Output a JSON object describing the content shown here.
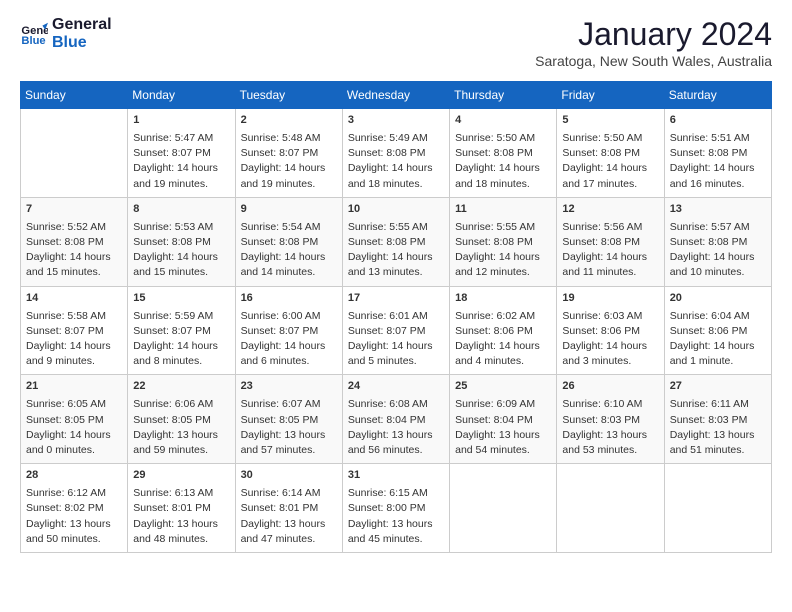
{
  "header": {
    "logo_line1": "General",
    "logo_line2": "Blue",
    "month": "January 2024",
    "location": "Saratoga, New South Wales, Australia"
  },
  "days_of_week": [
    "Sunday",
    "Monday",
    "Tuesday",
    "Wednesday",
    "Thursday",
    "Friday",
    "Saturday"
  ],
  "weeks": [
    [
      {
        "day": "",
        "content": ""
      },
      {
        "day": "1",
        "content": "Sunrise: 5:47 AM\nSunset: 8:07 PM\nDaylight: 14 hours\nand 19 minutes."
      },
      {
        "day": "2",
        "content": "Sunrise: 5:48 AM\nSunset: 8:07 PM\nDaylight: 14 hours\nand 19 minutes."
      },
      {
        "day": "3",
        "content": "Sunrise: 5:49 AM\nSunset: 8:08 PM\nDaylight: 14 hours\nand 18 minutes."
      },
      {
        "day": "4",
        "content": "Sunrise: 5:50 AM\nSunset: 8:08 PM\nDaylight: 14 hours\nand 18 minutes."
      },
      {
        "day": "5",
        "content": "Sunrise: 5:50 AM\nSunset: 8:08 PM\nDaylight: 14 hours\nand 17 minutes."
      },
      {
        "day": "6",
        "content": "Sunrise: 5:51 AM\nSunset: 8:08 PM\nDaylight: 14 hours\nand 16 minutes."
      }
    ],
    [
      {
        "day": "7",
        "content": "Sunrise: 5:52 AM\nSunset: 8:08 PM\nDaylight: 14 hours\nand 15 minutes."
      },
      {
        "day": "8",
        "content": "Sunrise: 5:53 AM\nSunset: 8:08 PM\nDaylight: 14 hours\nand 15 minutes."
      },
      {
        "day": "9",
        "content": "Sunrise: 5:54 AM\nSunset: 8:08 PM\nDaylight: 14 hours\nand 14 minutes."
      },
      {
        "day": "10",
        "content": "Sunrise: 5:55 AM\nSunset: 8:08 PM\nDaylight: 14 hours\nand 13 minutes."
      },
      {
        "day": "11",
        "content": "Sunrise: 5:55 AM\nSunset: 8:08 PM\nDaylight: 14 hours\nand 12 minutes."
      },
      {
        "day": "12",
        "content": "Sunrise: 5:56 AM\nSunset: 8:08 PM\nDaylight: 14 hours\nand 11 minutes."
      },
      {
        "day": "13",
        "content": "Sunrise: 5:57 AM\nSunset: 8:08 PM\nDaylight: 14 hours\nand 10 minutes."
      }
    ],
    [
      {
        "day": "14",
        "content": "Sunrise: 5:58 AM\nSunset: 8:07 PM\nDaylight: 14 hours\nand 9 minutes."
      },
      {
        "day": "15",
        "content": "Sunrise: 5:59 AM\nSunset: 8:07 PM\nDaylight: 14 hours\nand 8 minutes."
      },
      {
        "day": "16",
        "content": "Sunrise: 6:00 AM\nSunset: 8:07 PM\nDaylight: 14 hours\nand 6 minutes."
      },
      {
        "day": "17",
        "content": "Sunrise: 6:01 AM\nSunset: 8:07 PM\nDaylight: 14 hours\nand 5 minutes."
      },
      {
        "day": "18",
        "content": "Sunrise: 6:02 AM\nSunset: 8:06 PM\nDaylight: 14 hours\nand 4 minutes."
      },
      {
        "day": "19",
        "content": "Sunrise: 6:03 AM\nSunset: 8:06 PM\nDaylight: 14 hours\nand 3 minutes."
      },
      {
        "day": "20",
        "content": "Sunrise: 6:04 AM\nSunset: 8:06 PM\nDaylight: 14 hours\nand 1 minute."
      }
    ],
    [
      {
        "day": "21",
        "content": "Sunrise: 6:05 AM\nSunset: 8:05 PM\nDaylight: 14 hours\nand 0 minutes."
      },
      {
        "day": "22",
        "content": "Sunrise: 6:06 AM\nSunset: 8:05 PM\nDaylight: 13 hours\nand 59 minutes."
      },
      {
        "day": "23",
        "content": "Sunrise: 6:07 AM\nSunset: 8:05 PM\nDaylight: 13 hours\nand 57 minutes."
      },
      {
        "day": "24",
        "content": "Sunrise: 6:08 AM\nSunset: 8:04 PM\nDaylight: 13 hours\nand 56 minutes."
      },
      {
        "day": "25",
        "content": "Sunrise: 6:09 AM\nSunset: 8:04 PM\nDaylight: 13 hours\nand 54 minutes."
      },
      {
        "day": "26",
        "content": "Sunrise: 6:10 AM\nSunset: 8:03 PM\nDaylight: 13 hours\nand 53 minutes."
      },
      {
        "day": "27",
        "content": "Sunrise: 6:11 AM\nSunset: 8:03 PM\nDaylight: 13 hours\nand 51 minutes."
      }
    ],
    [
      {
        "day": "28",
        "content": "Sunrise: 6:12 AM\nSunset: 8:02 PM\nDaylight: 13 hours\nand 50 minutes."
      },
      {
        "day": "29",
        "content": "Sunrise: 6:13 AM\nSunset: 8:01 PM\nDaylight: 13 hours\nand 48 minutes."
      },
      {
        "day": "30",
        "content": "Sunrise: 6:14 AM\nSunset: 8:01 PM\nDaylight: 13 hours\nand 47 minutes."
      },
      {
        "day": "31",
        "content": "Sunrise: 6:15 AM\nSunset: 8:00 PM\nDaylight: 13 hours\nand 45 minutes."
      },
      {
        "day": "",
        "content": ""
      },
      {
        "day": "",
        "content": ""
      },
      {
        "day": "",
        "content": ""
      }
    ]
  ]
}
